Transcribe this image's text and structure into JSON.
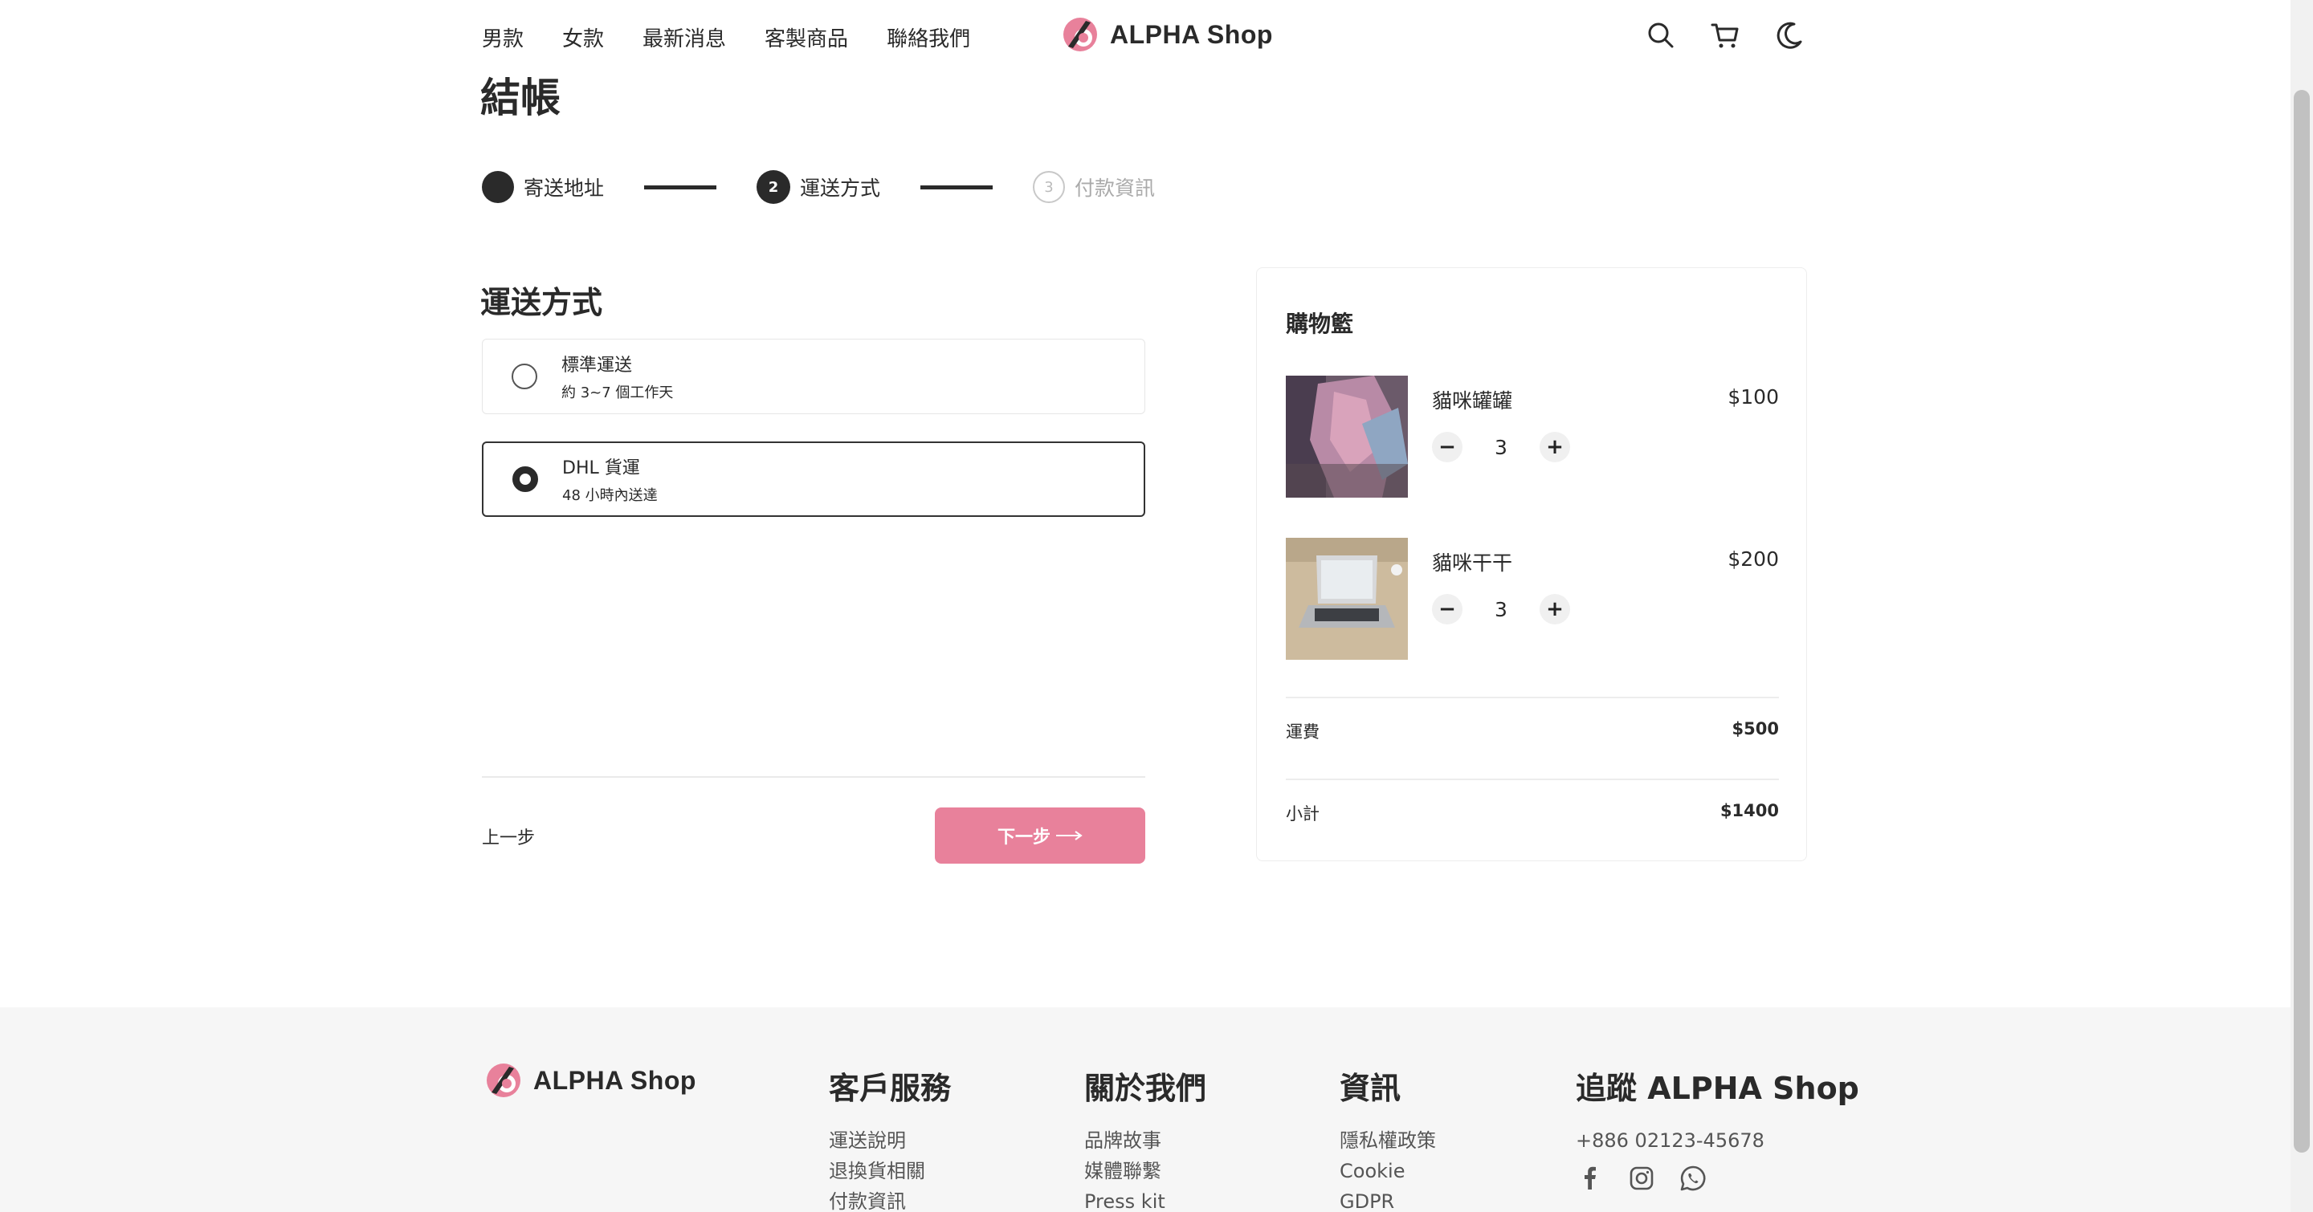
{
  "header": {
    "nav": [
      "男款",
      "女款",
      "最新消息",
      "客製商品",
      "聯絡我們"
    ],
    "brand": "ALPHA Shop",
    "icons": [
      "search-icon",
      "cart-icon",
      "moon-icon"
    ]
  },
  "checkout": {
    "title": "結帳",
    "steps": [
      {
        "label": "寄送地址",
        "state": "done"
      },
      {
        "label": "運送方式",
        "number": "2",
        "state": "active"
      },
      {
        "label": "付款資訊",
        "number": "3",
        "state": "todo"
      }
    ],
    "section_title": "運送方式",
    "options": [
      {
        "name": "標準運送",
        "period": "約 3~7 個工作天",
        "selected": false
      },
      {
        "name": "DHL 貨運",
        "period": "48 小時內送達",
        "selected": true
      }
    ],
    "prev_label": "上一步",
    "next_label": "下一步"
  },
  "cart": {
    "title": "購物籃",
    "items": [
      {
        "name": "貓咪罐罐",
        "price": "$100",
        "qty": "3"
      },
      {
        "name": "貓咪干干",
        "price": "$200",
        "qty": "3"
      }
    ],
    "shipping_label": "運費",
    "shipping_value": "$500",
    "subtotal_label": "小計",
    "subtotal_value": "$1400"
  },
  "footer": {
    "brand": "ALPHA Shop",
    "service": {
      "title": "客戶服務",
      "links": [
        "運送說明",
        "退換貨相關",
        "付款資訊"
      ]
    },
    "about": {
      "title": "關於我們",
      "links": [
        "品牌故事",
        "媒體聯繫",
        "Press kit"
      ]
    },
    "info": {
      "title": "資訊",
      "links": [
        "隱私權政策",
        "Cookie",
        "GDPR"
      ]
    },
    "follow": {
      "title": "追蹤 ALPHA Shop",
      "phone": "+886 02123-45678"
    }
  },
  "colors": {
    "accent": "#e8819b",
    "dark": "#2a2a2a",
    "footer_bg": "#f6f6f6"
  }
}
